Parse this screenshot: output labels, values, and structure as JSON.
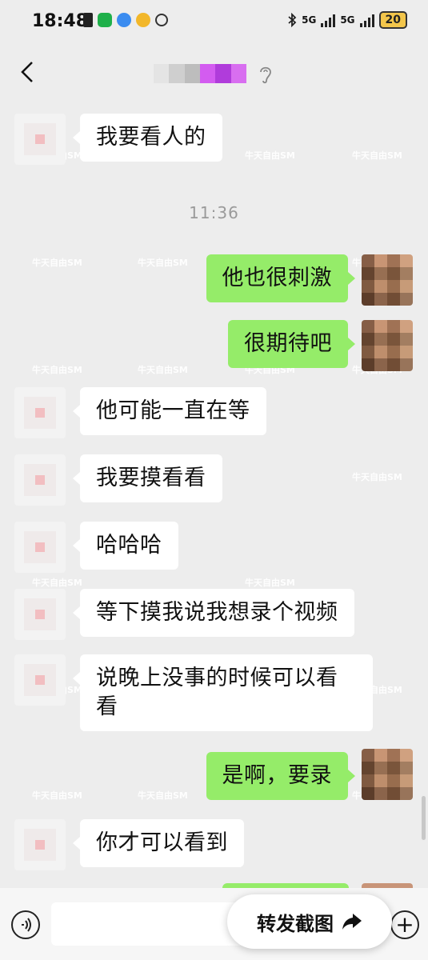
{
  "status_bar": {
    "time": "18:48",
    "network_1": "5G",
    "network_2": "5G",
    "battery": "20",
    "icons": [
      "sim-icon",
      "wechat-icon",
      "pinwheel-icon",
      "weather-icon",
      "hotspot-icon",
      "bluetooth-icon",
      "signal-icon",
      "battery-icon"
    ]
  },
  "header": {
    "back_icon": "chevron-left-icon",
    "contact_name_blurred": true,
    "ear_icon": "earpiece-icon"
  },
  "chat": {
    "timestamp": "11:36",
    "messages": [
      {
        "side": "theirs",
        "text": "我要看人的"
      },
      {
        "side": "mine",
        "text": "他也很刺激"
      },
      {
        "side": "mine",
        "text": "很期待吧"
      },
      {
        "side": "theirs",
        "text": "他可能一直在等"
      },
      {
        "side": "theirs",
        "text": "我要摸看看"
      },
      {
        "side": "theirs",
        "text": "哈哈哈"
      },
      {
        "side": "theirs",
        "text": "等下摸我说我想录个视频"
      },
      {
        "side": "theirs",
        "text": "说晚上没事的时候可以看看"
      },
      {
        "side": "mine",
        "text": "是啊，要录"
      },
      {
        "side": "theirs",
        "text": "你才可以看到"
      }
    ]
  },
  "watermark": {
    "title": "牛天自由SM",
    "sub": "牛天自由SM"
  },
  "bottom_bar": {
    "forward_label": "转发截图",
    "forward_icon": "share-arrow-icon",
    "voice_icon": "voice-icon",
    "plus_icon": "plus-icon"
  },
  "colors": {
    "background": "#ededed",
    "mine_bubble": "#95ec69",
    "theirs_bubble": "#ffffff"
  }
}
